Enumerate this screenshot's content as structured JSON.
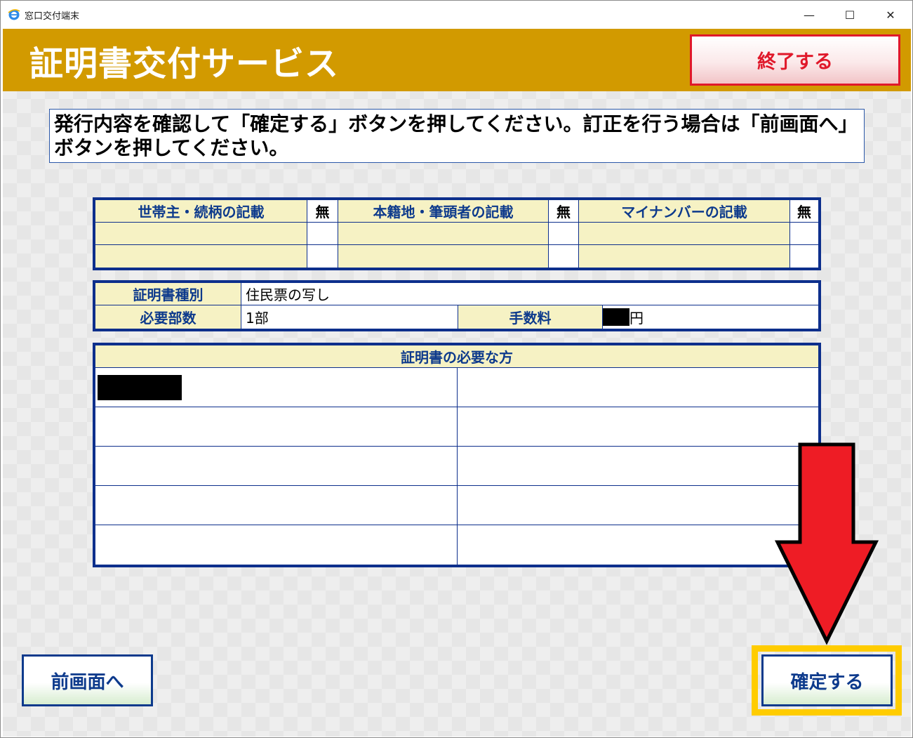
{
  "window": {
    "title": "窓口交付端末",
    "controls": {
      "minimize": "—",
      "maximize": "☐",
      "close": "✕"
    }
  },
  "header": {
    "title": "証明書交付サービス",
    "exit_label": "終了する"
  },
  "instruction": "発行内容を確認して「確定する」ボタンを押してください。訂正を行う場合は「前画面へ」ボタンを押してください。",
  "options_table": {
    "headers": [
      "世帯主・続柄の記載",
      "本籍地・筆頭者の記載",
      "マイナンバーの記載"
    ],
    "values": [
      "無",
      "無",
      "無"
    ]
  },
  "certificate": {
    "type_label": "証明書種別",
    "type_value": "住民票の写し",
    "copies_label": "必要部数",
    "copies_value": "1部",
    "fee_label": "手数料",
    "fee_unit": "円"
  },
  "persons_table": {
    "header": "証明書の必要な方"
  },
  "buttons": {
    "prev": "前画面へ",
    "confirm": "確定する"
  },
  "colors": {
    "header_bg": "#d29a00",
    "table_border": "#0d2f8c",
    "exit_red": "#e0182a",
    "highlight_yellow": "#ffcc00",
    "arrow_red": "#ee1c25"
  },
  "icons": {
    "app": "ie-app-icon",
    "arrow": "down-arrow-pointer"
  }
}
